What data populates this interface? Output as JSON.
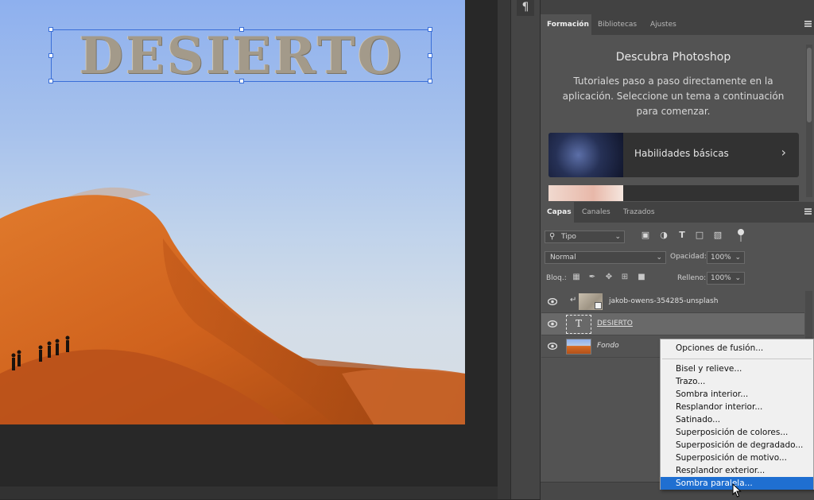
{
  "canvas": {
    "title_text": "DESIERTO"
  },
  "toolbar": {
    "paragraph_icon": "¶"
  },
  "learn_panel": {
    "tabs": [
      "Formación",
      "Bibliotecas",
      "Ajustes"
    ],
    "active_tab": "Formación",
    "title": "Descubra Photoshop",
    "description": "Tutoriales paso a paso directamente en la aplicación. Seleccione un tema a continuación para comenzar.",
    "card_label": "Habilidades básicas",
    "card_arrow": "›"
  },
  "layers_panel": {
    "tabs": [
      "Capas",
      "Canales",
      "Trazados"
    ],
    "active_tab": "Capas",
    "filter_value": "Tipo",
    "filter_icons": [
      "image-filter-icon",
      "adjustment-filter-icon",
      "type-filter-icon",
      "shape-filter-icon",
      "smart-object-filter-icon"
    ],
    "blend_mode": "Normal",
    "opacity_label": "Opacidad:",
    "opacity_value": "100%",
    "lock_label": "Bloq.:",
    "fill_label": "Relleno:",
    "fill_value": "100%",
    "layers": [
      {
        "name": "jakob-owens-354285-unsplash",
        "type": "image-clipped",
        "visible": true,
        "selected": false
      },
      {
        "name": "DESIERTO",
        "type": "text",
        "visible": true,
        "selected": true
      },
      {
        "name": "Fondo",
        "type": "background",
        "visible": true,
        "selected": false
      }
    ]
  },
  "context_menu": {
    "items": [
      "Opciones de fusión...",
      "Bisel y relieve...",
      "Trazo...",
      "Sombra interior...",
      "Resplandor interior...",
      "Satinado...",
      "Superposición de colores...",
      "Superposición de degradado...",
      "Superposición de motivo...",
      "Resplandor exterior...",
      "Sombra paralela..."
    ],
    "highlighted": "Sombra paralela..."
  },
  "colors": {
    "accent": "#1f6fd1",
    "panel_bg": "#535353",
    "selection_box": "#3a6fd8"
  }
}
